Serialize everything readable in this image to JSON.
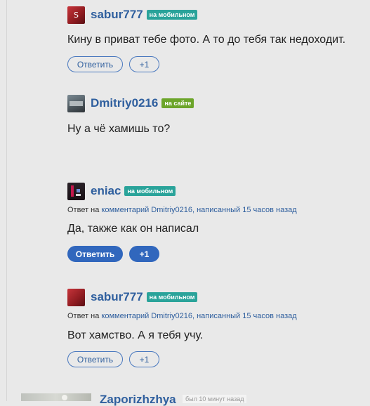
{
  "buttons": {
    "reply_label": "Ответить",
    "plus_label": "+1"
  },
  "comments": [
    {
      "username": "sabur777",
      "avatar_letter": "S",
      "status": "на мобильном",
      "text": "Кину в приват тебе фото. А то до тебя так недоходит."
    },
    {
      "username": "Dmitriy0216",
      "status": "на сайте",
      "text": "Ну а чё хамишь то?"
    },
    {
      "username": "eniac",
      "status": "на мобильном",
      "reply_prefix": "Ответ на",
      "reply_link": "комментарий Dmitriy0216, написанный 15 часов назад",
      "text": "Да, также как он написал"
    },
    {
      "username": "sabur777",
      "status": "на мобильном",
      "reply_prefix": "Ответ на",
      "reply_link": "комментарий Dmitriy0216, написанный 15 часов назад",
      "text": "Вот хамство. А я тебя учу."
    }
  ],
  "partial_comment": {
    "username": "Zaporizhzhya",
    "status": "был 10 минут назад"
  },
  "colors": {
    "link": "#2f5f9e",
    "badge_mobile": "#2aa39a",
    "badge_site": "#6ca52a",
    "button_filled": "#3167bd",
    "background": "#e9e9e9"
  }
}
